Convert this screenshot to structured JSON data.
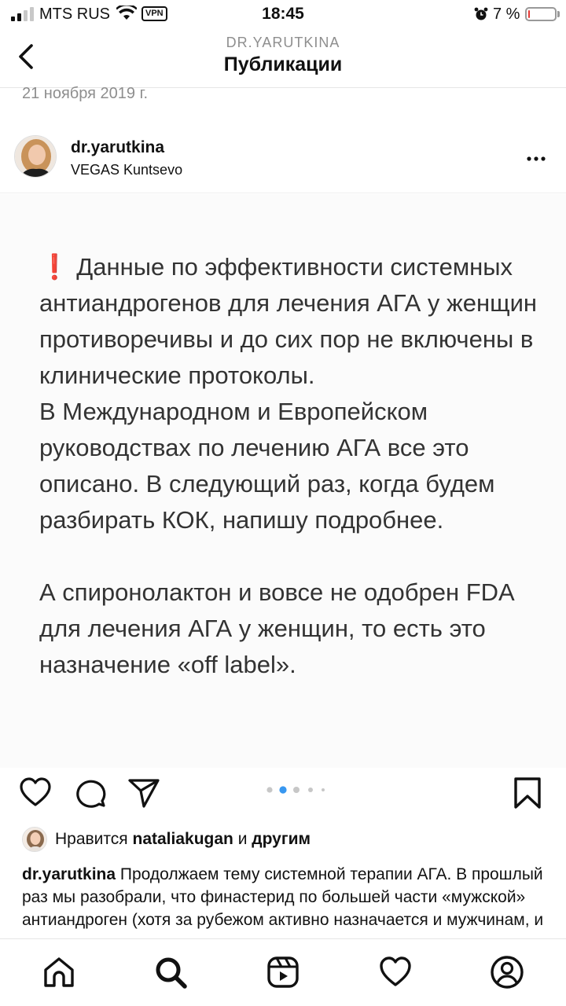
{
  "status_bar": {
    "carrier": "MTS RUS",
    "vpn": "VPN",
    "time": "18:45",
    "battery": "7 %",
    "battery_level": 0.07,
    "battery_color": "#e53935"
  },
  "header": {
    "subtitle": "DR.YARUTKINA",
    "title": "Публикации"
  },
  "previous_post_date": "21 ноября 2019 г.",
  "post": {
    "username": "dr.yarutkina",
    "location": "VEGAS Kuntsevo",
    "image_text": {
      "excl": "❗",
      "para1": " Данные по эффективности системных антиандрогенов для лечения АГА у женщин противоречивы и до сих пор не включены в клинические протоколы.",
      "para2": "В Международном и Европейском руководствах по лечению АГА все это описано. В следующий раз, когда будем разбирать КОК, напишу подробнее.",
      "para3": "А спиронолактон и вовсе не одобрен FDA для лечения АГА у женщин, то есть это назначение «off label»."
    },
    "carousel": {
      "count": 5,
      "active_index": 1,
      "active_color": "#3897f0"
    },
    "likes": {
      "prefix": "Нравится ",
      "user": "nataliakugan",
      "middle": " и ",
      "suffix": "другим"
    },
    "caption": {
      "username": "dr.yarutkina",
      "text": " Продолжаем тему системной терапии АГА. В прошлый раз мы разобрали, что финастерид по большей части «мужской» антиандроген (хотя за рубежом активно назначается и мужчинам, и"
    }
  },
  "icons": {
    "back": "chevron-left-icon",
    "more": "more-horizontal-icon",
    "like": "heart-icon",
    "comment": "comment-icon",
    "share": "send-icon",
    "save": "bookmark-icon",
    "tabs": [
      "home-icon",
      "search-icon",
      "reels-icon",
      "activity-heart-icon",
      "profile-icon"
    ]
  }
}
